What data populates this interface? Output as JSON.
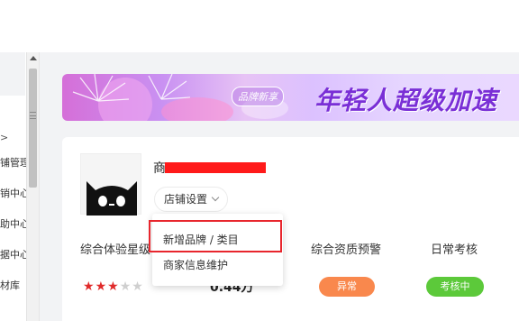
{
  "sidebar": {
    "items": [
      {
        "label": ">"
      },
      {
        "label": "铺管理"
      },
      {
        "label": "销中心"
      },
      {
        "label": "助中心"
      },
      {
        "label": "据中心"
      },
      {
        "label": "材库"
      }
    ]
  },
  "banner": {
    "tag": "品牌新享",
    "slogan": "年轻人超级加速"
  },
  "shop": {
    "name": "商",
    "settings_label": "店铺设置"
  },
  "dropdown": {
    "items": [
      "新增品牌 / 类目",
      "商家信息维护"
    ]
  },
  "metrics": {
    "experience_label": "综合体验星级",
    "assessment_label": "核",
    "qualification_label": "综合资质预警",
    "daily_label": "日常考核",
    "stars_filled": 3,
    "stars_total": 5,
    "score": "0.44万",
    "qualification_status": "异常",
    "daily_status": "考核中"
  },
  "colors": {
    "accent_red": "#e8262d",
    "orange_badge": "#f9884d",
    "green_badge": "#5cc93a",
    "banner_text": "#7a2fd6"
  }
}
